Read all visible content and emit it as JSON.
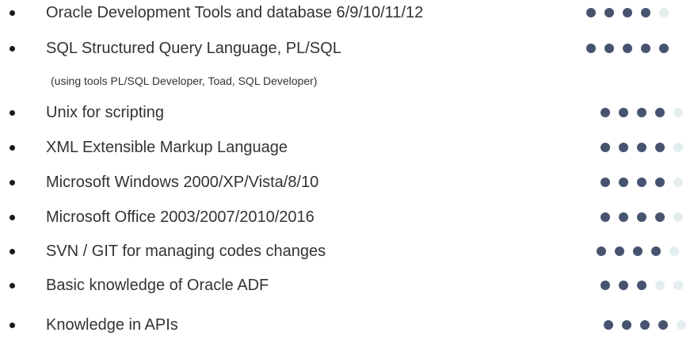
{
  "colors": {
    "filled": "#465470",
    "empty": "#e4eeee",
    "text": "#333333",
    "bullet": "#1a1a1a"
  },
  "skills": [
    {
      "label": "Oracle Development Tools and database 6/9/10/11/12",
      "rating": 4,
      "max": 5
    },
    {
      "label": "SQL Structured Query Language, PL/SQL",
      "note": "(using tools PL/SQL Developer, Toad, SQL Developer)",
      "rating": 5,
      "max": 5
    },
    {
      "label": "Unix for scripting",
      "rating": 4,
      "max": 5
    },
    {
      "label": "XML Extensible Markup Language",
      "rating": 4,
      "max": 5
    },
    {
      "label": "Microsoft Windows 2000/XP/Vista/8/10",
      "rating": 4,
      "max": 5
    },
    {
      "label": "Microsoft Office 2003/2007/2010/2016",
      "rating": 4,
      "max": 5
    },
    {
      "label": "SVN / GIT for managing codes changes",
      "rating": 4,
      "max": 5
    },
    {
      "label": "Basic knowledge of Oracle ADF",
      "rating": 3,
      "max": 5
    },
    {
      "label": "Knowledge in APIs",
      "rating": 4,
      "max": 5
    }
  ]
}
